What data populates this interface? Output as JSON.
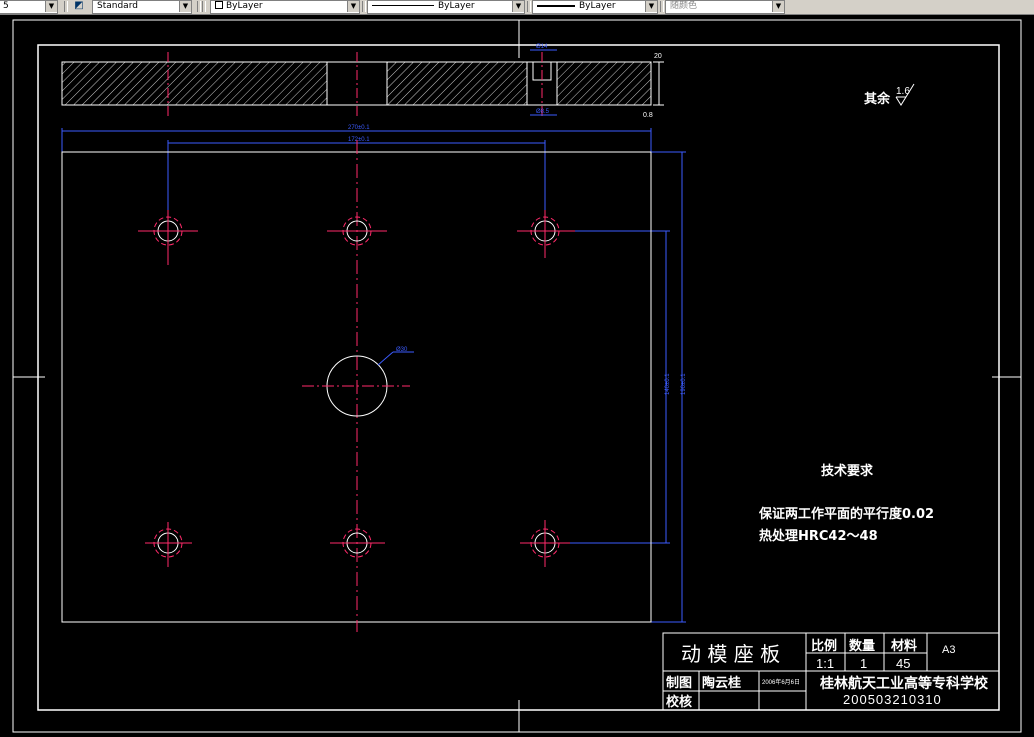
{
  "toolbar": {
    "left_cut": "5",
    "text_style": "Standard",
    "layer": "ByLayer",
    "linetype": "ByLayer",
    "lineweight": "ByLayer",
    "color": "随颜色"
  },
  "drawing": {
    "roughness_note_label": "其余",
    "roughness_value": "1.6",
    "tech_title": "技术要求",
    "tech_req_1": "保证两工作平面的平行度0.02",
    "tech_req_2": "热处理HRC42～48",
    "hatch_side_label": "",
    "dim_width_outer": "270±0.1",
    "dim_width_inner": "172±0.1",
    "dim_height_outer": "190±0.1",
    "dim_height_inner": "140±0.1",
    "dim_center_hole": "Ø30",
    "dim_thickness": "20",
    "dim_counterbore_top": "Ø14",
    "dim_counterbore_bottom": "Ø8.5",
    "roughness_small": "0.8"
  },
  "title_block": {
    "part_name": "动 模 座 板",
    "scale_label": "比例",
    "scale_value": "1:1",
    "quantity_label": "数量",
    "quantity_value": "1",
    "material_label": "材料",
    "material_value": "45",
    "paper_size": "A3",
    "drawn_label": "制图",
    "drawn_name": "陶云桂",
    "drawn_date": "2006年6月6日",
    "check_label": "校核",
    "school": "桂林航天工业高等专科学校",
    "student_id": "200503210310"
  }
}
